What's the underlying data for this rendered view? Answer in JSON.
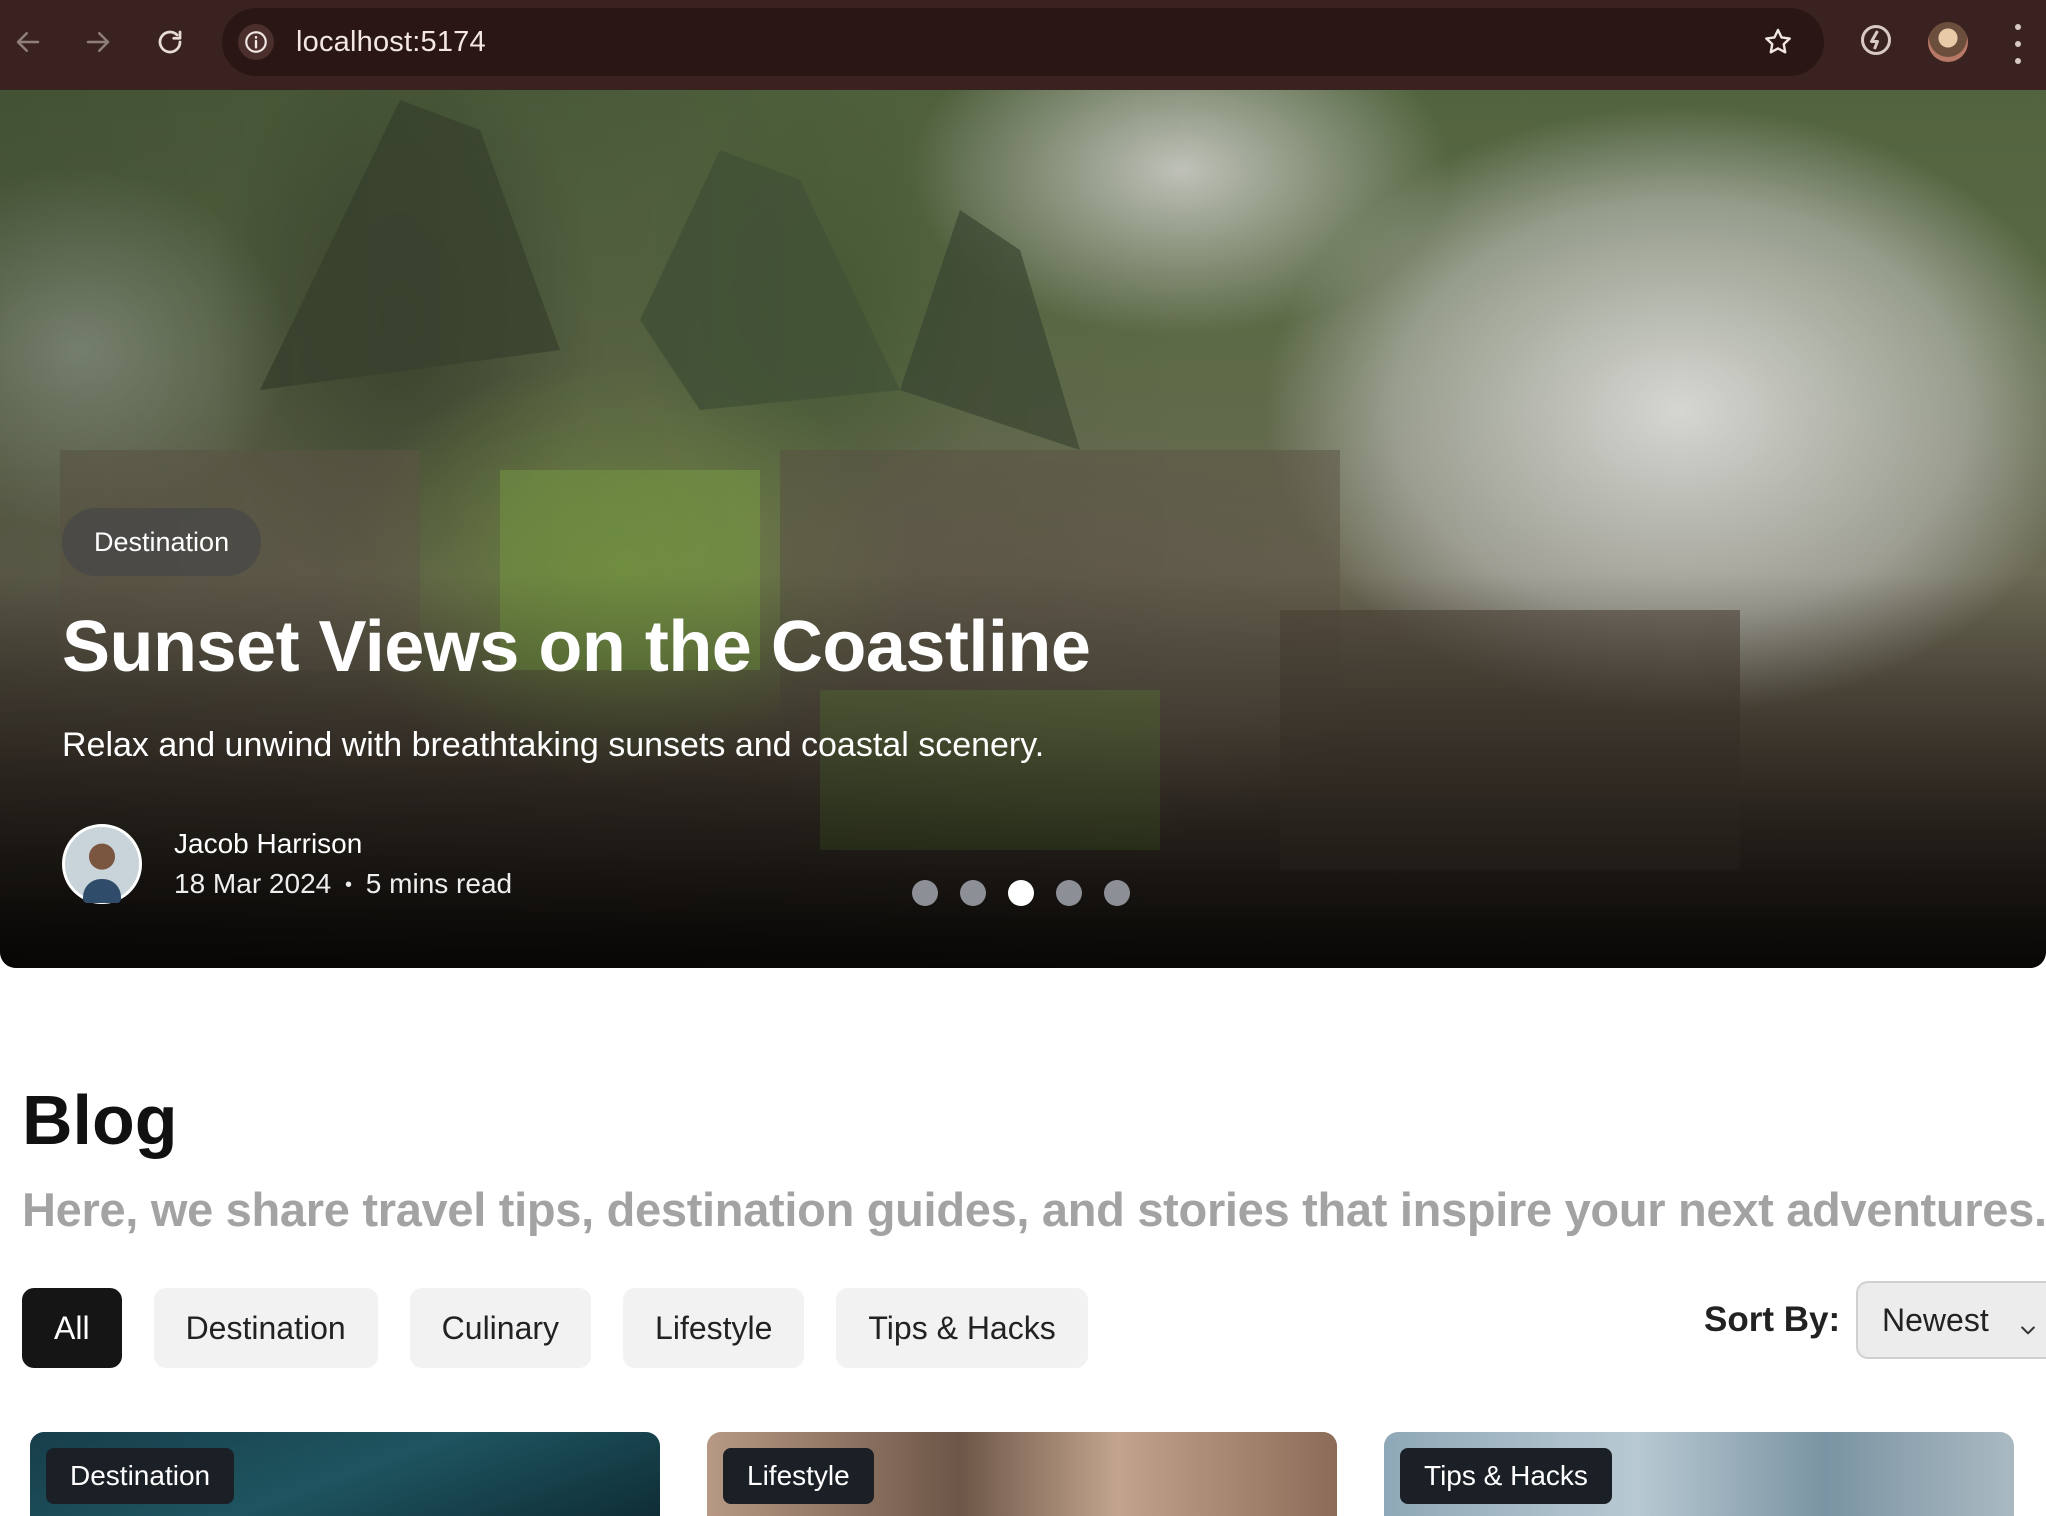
{
  "browser": {
    "url": "localhost:5174",
    "icons": [
      "back-arrow-icon",
      "forward-arrow-icon",
      "reload-icon",
      "site-info-icon",
      "bookmark-star-icon",
      "extension-icon",
      "profile-avatar",
      "menu-kebab-icon"
    ]
  },
  "hero": {
    "category": "Destination",
    "title": "Sunset Views on the Coastline",
    "description": "Relax and unwind with breathtaking sunsets and coastal scenery.",
    "author": {
      "name": "Jacob Harrison",
      "date": "18 Mar 2024",
      "separator": "•",
      "read_time": "5 mins read"
    },
    "carousel": {
      "total": 5,
      "active_index": 3
    }
  },
  "blog": {
    "title": "Blog",
    "subtitle": "Here, we share travel tips, destination guides, and stories that inspire your next adventures.",
    "filters": [
      {
        "label": "All",
        "active": true
      },
      {
        "label": "Destination",
        "active": false
      },
      {
        "label": "Culinary",
        "active": false
      },
      {
        "label": "Lifestyle",
        "active": false
      },
      {
        "label": "Tips & Hacks",
        "active": false
      }
    ],
    "sort": {
      "label": "Sort By:",
      "value": "Newest"
    },
    "cards": [
      {
        "category": "Destination"
      },
      {
        "category": "Lifestyle"
      },
      {
        "category": "Tips & Hacks"
      }
    ]
  },
  "colors": {
    "chrome_bg": "#3a2220",
    "active_pill": "#151515",
    "pill_bg": "#f2f2f2",
    "subtitle": "#a3a3a3"
  }
}
